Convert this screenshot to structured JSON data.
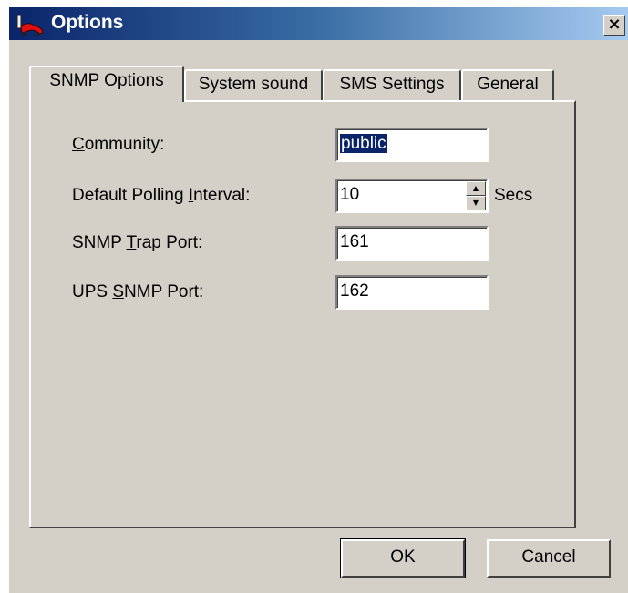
{
  "window": {
    "title": "Options",
    "close_label": "×"
  },
  "tabs": [
    {
      "label": "SNMP Options",
      "active": true
    },
    {
      "label": "System sound",
      "active": false
    },
    {
      "label": "SMS Settings",
      "active": false
    },
    {
      "label": "General",
      "active": false
    }
  ],
  "form": {
    "community": {
      "label_pre": "",
      "label_mnemonic": "C",
      "label_post": "ommunity:",
      "value": "public"
    },
    "polling": {
      "label_pre": "Default Polling ",
      "label_mnemonic": "I",
      "label_post": "nterval:",
      "value": "10",
      "unit": "Secs"
    },
    "trap_port": {
      "label_pre": "SNMP ",
      "label_mnemonic": "T",
      "label_post": "rap Port:",
      "value": "161"
    },
    "ups_port": {
      "label_pre": "UPS ",
      "label_mnemonic": "S",
      "label_post": "NMP Port:",
      "value": "162"
    }
  },
  "buttons": {
    "ok": "OK",
    "cancel": "Cancel"
  },
  "colors": {
    "titlebar_start": "#0a246a",
    "titlebar_end": "#a6caf0",
    "face": "#d4d0c8",
    "selection": "#0a246a"
  }
}
